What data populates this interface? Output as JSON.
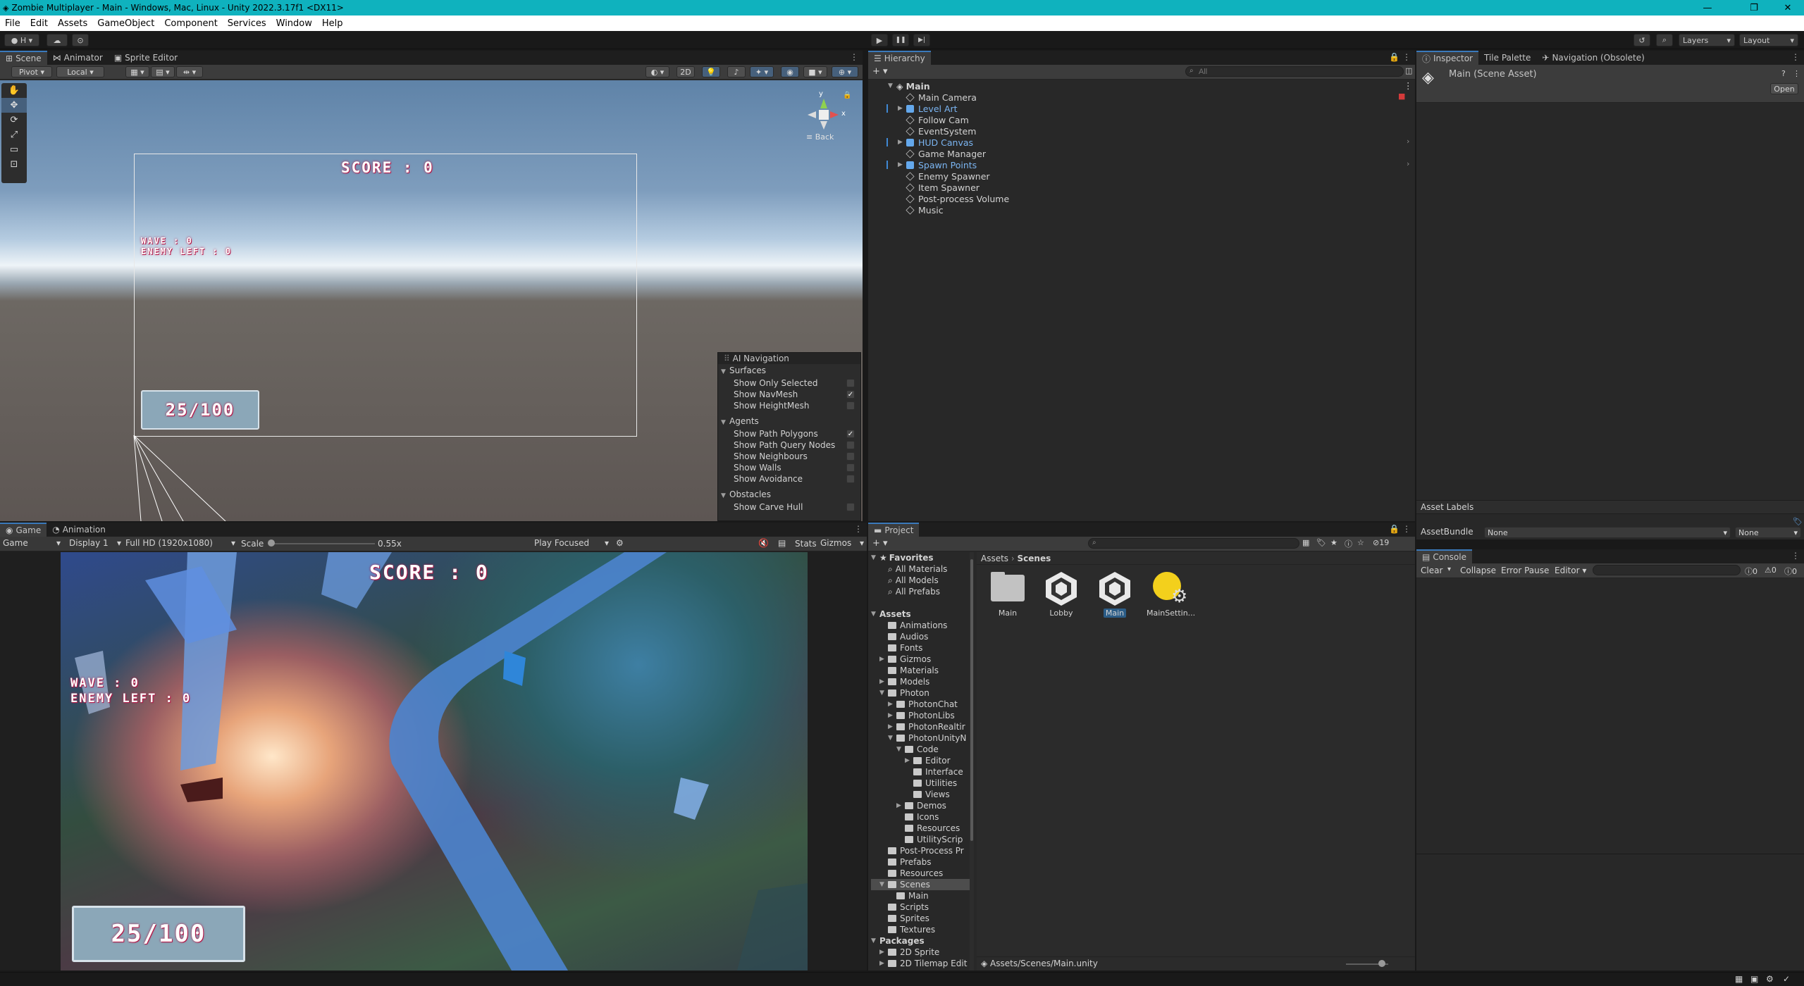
{
  "window": {
    "title": "Zombie Multiplayer - Main - Windows, Mac, Linux - Unity 2022.3.17f1 <DX11>",
    "min": "—",
    "max": "❐",
    "close": "✕"
  },
  "menu": [
    "File",
    "Edit",
    "Assets",
    "GameObject",
    "Component",
    "Services",
    "Window",
    "Help"
  ],
  "toolbar": {
    "account": "H",
    "play": "▶",
    "pause": "❚❚",
    "step": "▶|",
    "layers": "Layers",
    "layout": "Layout"
  },
  "scene": {
    "tabs": [
      "Scene",
      "Animator",
      "Sprite Editor"
    ],
    "pivot": "Pivot",
    "local": "Local",
    "mode2d": "2D",
    "gizmo_back": "≡ Back",
    "axis_y": "y",
    "axis_x": "x",
    "hud": {
      "score": "SCORE : 0",
      "wave": "WAVE : 0",
      "enemy": "ENEMY LEFT : 0",
      "ammo": "25/100"
    },
    "nav": {
      "title": "AI Navigation",
      "sections": [
        {
          "name": "Surfaces",
          "items": [
            {
              "label": "Show Only Selected",
              "checked": false
            },
            {
              "label": "Show NavMesh",
              "checked": true
            },
            {
              "label": "Show HeightMesh",
              "checked": false
            }
          ]
        },
        {
          "name": "Agents",
          "items": [
            {
              "label": "Show Path Polygons",
              "checked": true
            },
            {
              "label": "Show Path Query Nodes",
              "checked": false
            },
            {
              "label": "Show Neighbours",
              "checked": false
            },
            {
              "label": "Show Walls",
              "checked": false
            },
            {
              "label": "Show Avoidance",
              "checked": false
            }
          ]
        },
        {
          "name": "Obstacles",
          "items": [
            {
              "label": "Show Carve Hull",
              "checked": false
            }
          ]
        }
      ]
    }
  },
  "game": {
    "tabs": [
      "Game",
      "Animation"
    ],
    "mode": "Game",
    "display": "Display 1",
    "resolution": "Full HD (1920x1080)",
    "scale_label": "Scale",
    "scale_value": "0.55x",
    "play_focused": "Play Focused",
    "stats": "Stats",
    "gizmos": "Gizmos",
    "hud": {
      "score": "SCORE : 0",
      "wave": "WAVE : 0",
      "enemy": "ENEMY LEFT : 0",
      "ammo": "25/100"
    }
  },
  "hierarchy": {
    "tab": "Hierarchy",
    "search_placeholder": "All",
    "root": "Main",
    "items": [
      {
        "label": "Main Camera",
        "prefab": false,
        "expand": false
      },
      {
        "label": "Level Art",
        "prefab": true,
        "expand": true
      },
      {
        "label": "Follow Cam",
        "prefab": false,
        "expand": false
      },
      {
        "label": "EventSystem",
        "prefab": false,
        "expand": false
      },
      {
        "label": "HUD Canvas",
        "prefab": true,
        "expand": true
      },
      {
        "label": "Game Manager",
        "prefab": false,
        "expand": false
      },
      {
        "label": "Spawn Points",
        "prefab": true,
        "expand": true
      },
      {
        "label": "Enemy Spawner",
        "prefab": false,
        "expand": false
      },
      {
        "label": "Item Spawner",
        "prefab": false,
        "expand": false
      },
      {
        "label": "Post-process Volume",
        "prefab": false,
        "expand": false
      },
      {
        "label": "Music",
        "prefab": false,
        "expand": false
      }
    ]
  },
  "project": {
    "tab": "Project",
    "hidden_count": "19",
    "breadcrumb": [
      "Assets",
      "Scenes"
    ],
    "favorites": {
      "label": "Favorites",
      "items": [
        "All Materials",
        "All Models",
        "All Prefabs"
      ]
    },
    "tree": [
      {
        "label": "Assets",
        "depth": 0,
        "bold": true,
        "arrow": "▼",
        "folder": false
      },
      {
        "label": "Animations",
        "depth": 1,
        "arrow": "",
        "folder": true
      },
      {
        "label": "Audios",
        "depth": 1,
        "arrow": "",
        "folder": true
      },
      {
        "label": "Fonts",
        "depth": 1,
        "arrow": "",
        "folder": true
      },
      {
        "label": "Gizmos",
        "depth": 1,
        "arrow": "▶",
        "folder": true
      },
      {
        "label": "Materials",
        "depth": 1,
        "arrow": "",
        "folder": true
      },
      {
        "label": "Models",
        "depth": 1,
        "arrow": "▶",
        "folder": true
      },
      {
        "label": "Photon",
        "depth": 1,
        "arrow": "▼",
        "folder": true
      },
      {
        "label": "PhotonChat",
        "depth": 2,
        "arrow": "▶",
        "folder": true
      },
      {
        "label": "PhotonLibs",
        "depth": 2,
        "arrow": "▶",
        "folder": true
      },
      {
        "label": "PhotonRealtir",
        "depth": 2,
        "arrow": "▶",
        "folder": true
      },
      {
        "label": "PhotonUnityN",
        "depth": 2,
        "arrow": "▼",
        "folder": true
      },
      {
        "label": "Code",
        "depth": 3,
        "arrow": "▼",
        "folder": true
      },
      {
        "label": "Editor",
        "depth": 4,
        "arrow": "▶",
        "folder": true
      },
      {
        "label": "Interface",
        "depth": 4,
        "arrow": "",
        "folder": true
      },
      {
        "label": "Utilities",
        "depth": 4,
        "arrow": "",
        "folder": true
      },
      {
        "label": "Views",
        "depth": 4,
        "arrow": "",
        "folder": true
      },
      {
        "label": "Demos",
        "depth": 3,
        "arrow": "▶",
        "folder": true
      },
      {
        "label": "Icons",
        "depth": 3,
        "arrow": "",
        "folder": true
      },
      {
        "label": "Resources",
        "depth": 3,
        "arrow": "",
        "folder": true
      },
      {
        "label": "UtilityScrip",
        "depth": 3,
        "arrow": "",
        "folder": true
      },
      {
        "label": "Post-Process Pr",
        "depth": 1,
        "arrow": "",
        "folder": true
      },
      {
        "label": "Prefabs",
        "depth": 1,
        "arrow": "",
        "folder": true
      },
      {
        "label": "Resources",
        "depth": 1,
        "arrow": "",
        "folder": true
      },
      {
        "label": "Scenes",
        "depth": 1,
        "arrow": "▼",
        "folder": true,
        "selected": true
      },
      {
        "label": "Main",
        "depth": 2,
        "arrow": "",
        "folder": true
      },
      {
        "label": "Scripts",
        "depth": 1,
        "arrow": "",
        "folder": true
      },
      {
        "label": "Sprites",
        "depth": 1,
        "arrow": "",
        "folder": true
      },
      {
        "label": "Textures",
        "depth": 1,
        "arrow": "",
        "folder": true
      },
      {
        "label": "Packages",
        "depth": 0,
        "bold": true,
        "arrow": "▼",
        "folder": false
      },
      {
        "label": "2D Sprite",
        "depth": 1,
        "arrow": "▶",
        "folder": true
      },
      {
        "label": "2D Tilemap Edit",
        "depth": 1,
        "arrow": "▶",
        "folder": true
      }
    ],
    "assets": [
      {
        "label": "Main",
        "kind": "folder"
      },
      {
        "label": "Lobby",
        "kind": "unity"
      },
      {
        "label": "Main",
        "kind": "unity",
        "selected": true
      },
      {
        "label": "MainSettin...",
        "kind": "settings"
      }
    ],
    "path": "Assets/Scenes/Main.unity"
  },
  "inspector": {
    "tabs": [
      "Inspector",
      "Tile Palette",
      "Navigation (Obsolete)"
    ],
    "asset": "Main (Scene Asset)",
    "open": "Open",
    "asset_labels": "Asset Labels",
    "assetbundle_label": "AssetBundle",
    "bundle": "None",
    "variant": "None"
  },
  "console": {
    "tab": "Console",
    "clear": "Clear",
    "collapse": "Collapse",
    "error_pause": "Error Pause",
    "editor": "Editor",
    "logs": "0",
    "warnings": "0",
    "errors": "0"
  },
  "colors": {
    "accent": "#0fb2be",
    "selection": "#2c5d87",
    "prefab": "#7bb5f2"
  }
}
